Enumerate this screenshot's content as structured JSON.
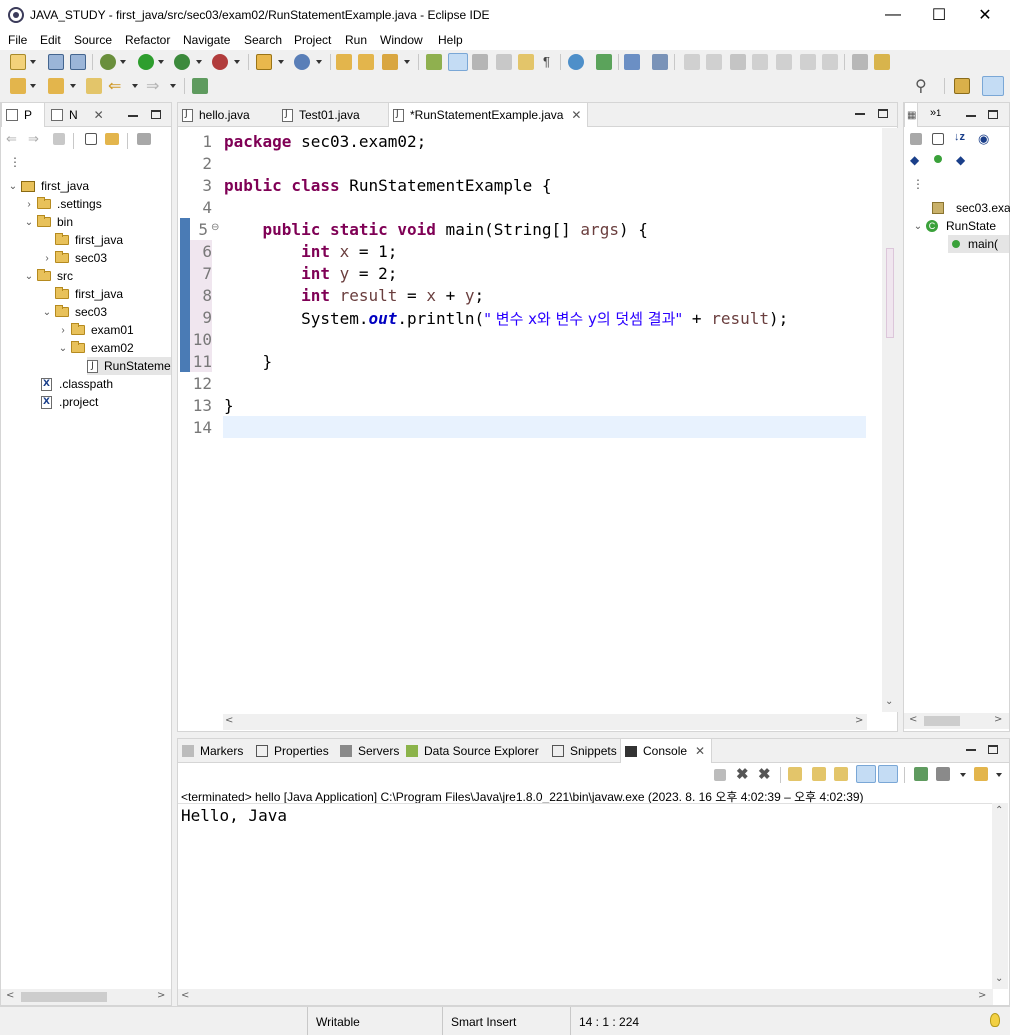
{
  "window": {
    "title": "JAVA_STUDY - first_java/src/sec03/exam02/RunStatementExample.java - Eclipse IDE"
  },
  "menu": [
    "File",
    "Edit",
    "Source",
    "Refactor",
    "Navigate",
    "Search",
    "Project",
    "Run",
    "Window",
    "Help"
  ],
  "left_panel": {
    "tabs": [
      {
        "label": "P"
      },
      {
        "label": "N"
      }
    ],
    "tree": [
      {
        "label": "first_java",
        "kind": "project",
        "depth": 0,
        "expanded": true
      },
      {
        "label": ".settings",
        "kind": "folder",
        "depth": 1,
        "expanded": false
      },
      {
        "label": "bin",
        "kind": "folder",
        "depth": 1,
        "expanded": true
      },
      {
        "label": "first_java",
        "kind": "folder",
        "depth": 2,
        "expanded": null
      },
      {
        "label": "sec03",
        "kind": "folder",
        "depth": 2,
        "expanded": false
      },
      {
        "label": "src",
        "kind": "folder",
        "depth": 1,
        "expanded": true
      },
      {
        "label": "first_java",
        "kind": "folder",
        "depth": 2,
        "expanded": null
      },
      {
        "label": "sec03",
        "kind": "folder",
        "depth": 2,
        "expanded": true
      },
      {
        "label": "exam01",
        "kind": "folder",
        "depth": 3,
        "expanded": false
      },
      {
        "label": "exam02",
        "kind": "folder",
        "depth": 3,
        "expanded": true
      },
      {
        "label": "RunStateme",
        "kind": "java",
        "depth": 4,
        "expanded": null,
        "selected": true
      },
      {
        "label": ".classpath",
        "kind": "xml",
        "depth": 1,
        "expanded": null
      },
      {
        "label": ".project",
        "kind": "xml",
        "depth": 1,
        "expanded": null
      }
    ]
  },
  "editor": {
    "tabs": [
      {
        "label": "hello.java",
        "active": false
      },
      {
        "label": "Test01.java",
        "active": false
      },
      {
        "label": "*RunStatementExample.java",
        "active": true
      }
    ],
    "line_numbers": [
      "1",
      "2",
      "3",
      "4",
      "5",
      "6",
      "7",
      "8",
      "9",
      "10",
      "11",
      "12",
      "13",
      "14"
    ],
    "lines": {
      "l1_kw": "package",
      "l1_rest": " sec03.exam02;",
      "l3_kw": "public class",
      "l3_rest": " RunStatementExample {",
      "l5_indent": "    ",
      "l5_kw": "public static void",
      "l5_rest1": " main(String[] ",
      "l5_var": "args",
      "l5_rest2": ") {",
      "l6_indent": "        ",
      "l6_kw": "int",
      "l6_sp": " ",
      "l6_var": "x",
      "l6_rest": " = 1;",
      "l7_indent": "        ",
      "l7_kw": "int",
      "l7_sp": " ",
      "l7_var": "y",
      "l7_rest": " = 2;",
      "l8_indent": "        ",
      "l8_kw": "int",
      "l8_sp": " ",
      "l8_var": "result",
      "l8_rest1": " = ",
      "l8_var2": "x",
      "l8_rest2": " + ",
      "l8_var3": "y",
      "l8_rest3": ";",
      "l9_indent": "        ",
      "l9_a": "System.",
      "l9_fld": "out",
      "l9_b": ".println(",
      "l9_str": "\" 변수 x와 변수 y의 덧셈 결과\"",
      "l9_c": " + ",
      "l9_var": "result",
      "l9_d": ");",
      "l11": "    }",
      "l13": "}"
    }
  },
  "outline_panel": {
    "tab_label": "1",
    "items": [
      {
        "label": "sec03.exa"
      },
      {
        "label": "RunState"
      },
      {
        "label": "main("
      }
    ]
  },
  "bottom_panel": {
    "tabs": [
      {
        "label": "Markers",
        "icon": "markers-icon"
      },
      {
        "label": "Properties",
        "icon": "properties-icon"
      },
      {
        "label": "Servers",
        "icon": "servers-icon"
      },
      {
        "label": "Data Source Explorer",
        "icon": "data-source-icon"
      },
      {
        "label": "Snippets",
        "icon": "snippets-icon"
      },
      {
        "label": "Console",
        "icon": "console-icon",
        "active": true
      }
    ],
    "console_header": "<terminated> hello [Java Application] C:\\Program Files\\Java\\jre1.8.0_221\\bin\\javaw.exe  (2023. 8. 16 오후 4:02:39 – 오후 4:02:39)",
    "console_output": "Hello, Java"
  },
  "status": {
    "writable": "Writable",
    "insert_mode": "Smart Insert",
    "position": "14 : 1 : 224"
  },
  "colors": {
    "keyword": "#7f0055",
    "local_variable": "#6a3e3e",
    "string": "#2a00ff",
    "static_field": "#0000c0",
    "current_line": "#e8f2fe"
  }
}
